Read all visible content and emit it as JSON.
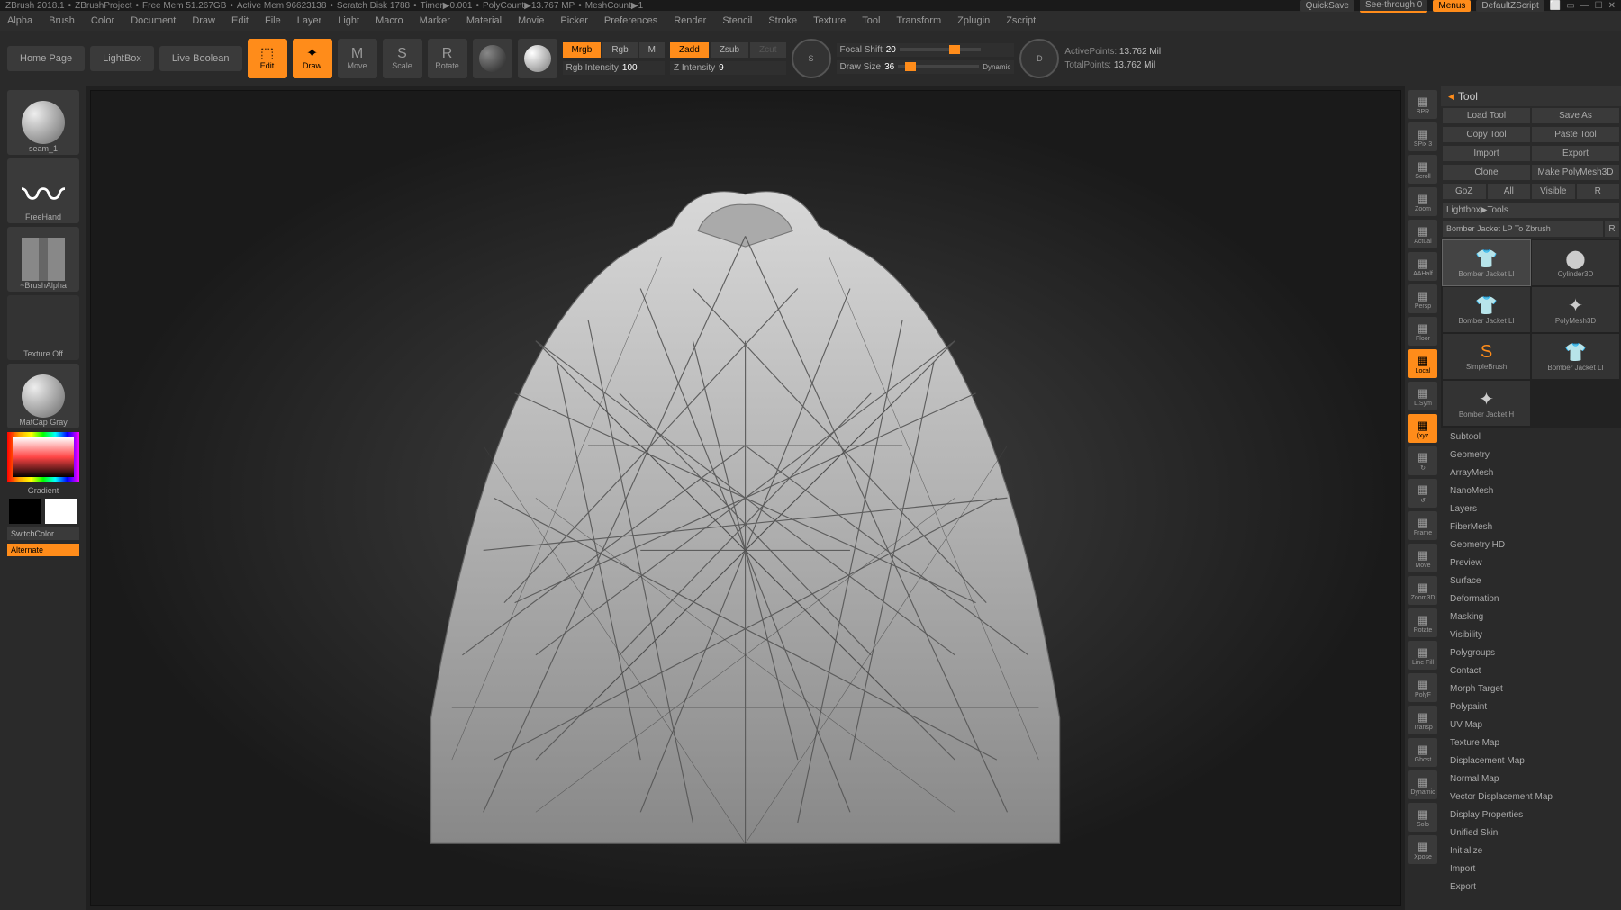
{
  "titlebar": {
    "app": "ZBrush 2018.1",
    "project": "ZBrushProject",
    "freemem": "Free Mem 51.267GB",
    "activemem": "Active Mem 96623138",
    "scratch": "Scratch Disk 1788",
    "timer": "Timer▶0.001",
    "polycount": "PolyCount▶13.767 MP",
    "meshcount": "MeshCount▶1",
    "quicksave": "QuickSave",
    "seethrough": "See-through  0",
    "menus": "Menus",
    "defaultscript": "DefaultZScript"
  },
  "menu": [
    "Alpha",
    "Brush",
    "Color",
    "Document",
    "Draw",
    "Edit",
    "File",
    "Layer",
    "Light",
    "Macro",
    "Marker",
    "Material",
    "Movie",
    "Picker",
    "Preferences",
    "Render",
    "Stencil",
    "Stroke",
    "Texture",
    "Tool",
    "Transform",
    "Zplugin",
    "Zscript"
  ],
  "toolbar": {
    "home": "Home Page",
    "lightbox": "LightBox",
    "liveboolean": "Live Boolean",
    "edit": "Edit",
    "draw": "Draw",
    "move": "Move",
    "scale": "Scale",
    "rotate": "Rotate",
    "mrgb": "Mrgb",
    "rgb": "Rgb",
    "m": "M",
    "rgbintensity_lbl": "Rgb Intensity",
    "rgbintensity_val": "100",
    "zadd": "Zadd",
    "zsub": "Zsub",
    "zcut": "Zcut",
    "zintensity_lbl": "Z Intensity",
    "zintensity_val": "9",
    "focalshift_lbl": "Focal Shift",
    "focalshift_val": "20",
    "drawsize_lbl": "Draw Size",
    "drawsize_val": "36",
    "dynamic": "Dynamic",
    "activepoints_lbl": "ActivePoints:",
    "activepoints_val": "13.762 Mil",
    "totalpoints_lbl": "TotalPoints:",
    "totalpoints_val": "13.762 Mil"
  },
  "left": {
    "brush": "seam_1",
    "stroke": "FreeHand",
    "alpha": "~BrushAlpha",
    "texture": "Texture Off",
    "material": "MatCap Gray",
    "gradient": "Gradient",
    "switchcolor": "SwitchColor",
    "alternate": "Alternate"
  },
  "right_icons": [
    "BPR",
    "SPix 3",
    "Scroll",
    "Zoom",
    "Actual",
    "AAHalf",
    "Persp",
    "Floor",
    "Local",
    "L.Sym",
    "(xyz",
    "↻",
    "↺",
    "Frame",
    "Move",
    "Zoom3D",
    "Rotate",
    "Line Fill",
    "PolyF",
    "Transp",
    "Ghost",
    "Dynamic",
    "Solo",
    "Xpose"
  ],
  "right_active": [
    8,
    10
  ],
  "tool": {
    "title": "Tool",
    "btns": [
      [
        "Load Tool",
        "Save As"
      ],
      [
        "Copy Tool",
        "Paste Tool"
      ],
      [
        "Import",
        "Export"
      ],
      [
        "Clone",
        "Make PolyMesh3D"
      ],
      [
        "GoZ",
        "All",
        "Visible",
        "R"
      ]
    ],
    "lightbox": "Lightbox▶Tools",
    "current": "Bomber Jacket LP To Zbrush",
    "items": [
      {
        "label": "Bomber Jacket LI",
        "icon": "👕"
      },
      {
        "label": "Cylinder3D",
        "icon": "⬤"
      },
      {
        "label": "Bomber Jacket LI",
        "icon": "👕"
      },
      {
        "label": "PolyMesh3D",
        "icon": "✦"
      },
      {
        "label": "SimpleBrush",
        "icon": "S",
        "color": "#ff8c1a"
      },
      {
        "label": "Bomber Jacket LI",
        "icon": "👕"
      },
      {
        "label": "Bomber Jacket H",
        "icon": "✦"
      }
    ],
    "sections": [
      "Subtool",
      "Geometry",
      "ArrayMesh",
      "NanoMesh",
      "Layers",
      "FiberMesh",
      "Geometry HD",
      "Preview",
      "Surface",
      "Deformation",
      "Masking",
      "Visibility",
      "Polygroups",
      "Contact",
      "Morph Target",
      "Polypaint",
      "UV Map",
      "Texture Map",
      "Displacement Map",
      "Normal Map",
      "Vector Displacement Map",
      "Display Properties",
      "Unified Skin",
      "Initialize",
      "Import",
      "Export"
    ]
  }
}
